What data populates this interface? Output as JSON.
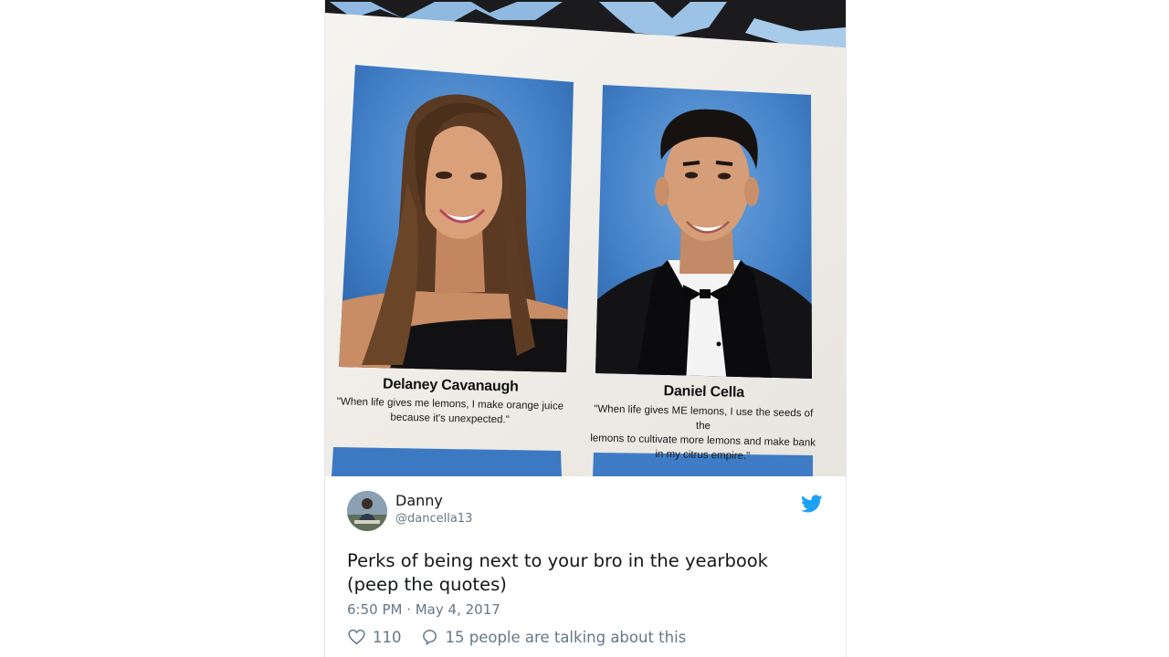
{
  "yearbook": {
    "left_student": {
      "name": "Delaney Cavanaugh",
      "quote_line1": "\"When life gives me lemons, I make orange juice",
      "quote_line2": "because it's unexpected.\""
    },
    "right_student": {
      "name": "Daniel Cella",
      "quote_line1": "\"When life gives ME lemons, I use the seeds of the",
      "quote_line2": "lemons to cultivate more lemons and make bank",
      "quote_line3": "in my citrus empire.\""
    }
  },
  "tweet": {
    "author_name": "Danny",
    "author_handle": "@dancella13",
    "text_line1": "Perks of being next to your bro in the yearbook",
    "text_line2": "(peep the quotes)",
    "timestamp": "6:50 PM · May 4, 2017",
    "like_count": "110",
    "talking_text": "15 people are talking about this"
  },
  "icons": {
    "brand": "twitter-bird-icon",
    "like": "heart-icon",
    "reply": "speech-bubble-icon"
  },
  "colors": {
    "twitter_blue": "#1da1f2",
    "muted_text": "#657786",
    "primary_text": "#14171a"
  }
}
